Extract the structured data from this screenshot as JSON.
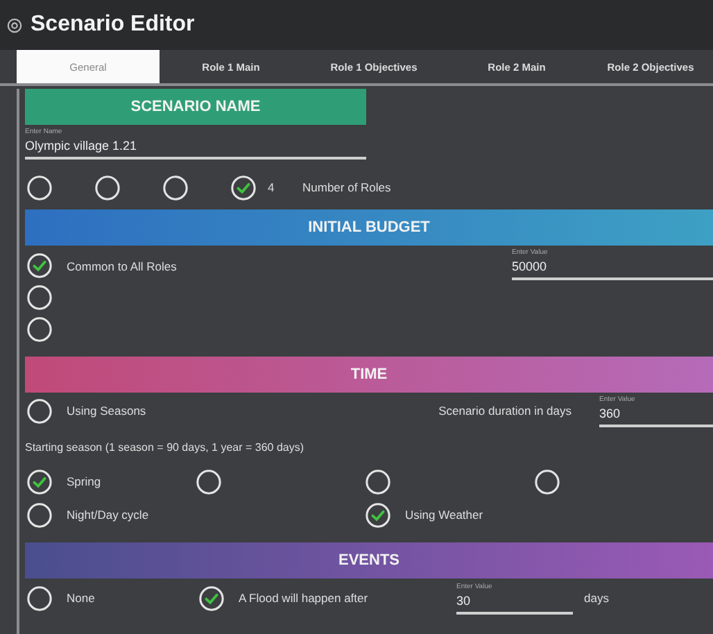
{
  "window": {
    "title": "Scenario Editor"
  },
  "tabs": [
    {
      "label": "General",
      "selected": true
    },
    {
      "label": "Role 1 Main",
      "selected": false
    },
    {
      "label": "Role 1 Objectives",
      "selected": false
    },
    {
      "label": "Role 2 Main",
      "selected": false
    },
    {
      "label": "Role 2 Objectives",
      "selected": false
    }
  ],
  "scenario_name": {
    "heading": "SCENARIO NAME",
    "field": {
      "label": "Enter Name",
      "value": "Olympic village 1.21"
    }
  },
  "roles": {
    "options": [
      {
        "selected": false
      },
      {
        "selected": false
      },
      {
        "selected": false
      },
      {
        "selected": true,
        "label": "4"
      }
    ],
    "label": "Number of Roles"
  },
  "budget": {
    "heading": "INITIAL BUDGET",
    "options": [
      {
        "label": "Common to All Roles",
        "checked": true
      },
      {
        "checked": false
      },
      {
        "checked": false
      }
    ],
    "field": {
      "label": "Enter Value",
      "value": "50000"
    }
  },
  "time": {
    "heading": "TIME",
    "using_seasons": {
      "label": "Using Seasons",
      "checked": false
    },
    "duration": {
      "label": "Scenario duration in days",
      "field": {
        "label": "Enter Value",
        "value": "360"
      }
    },
    "season_note": "Starting season (1 season = 90 days, 1 year = 360 days)",
    "seasons": [
      {
        "label": "Spring",
        "selected": true
      },
      {
        "selected": false
      },
      {
        "selected": false
      },
      {
        "selected": false
      }
    ],
    "night_day": {
      "label": "Night/Day cycle",
      "checked": false
    },
    "weather": {
      "label": "Using Weather",
      "checked": true
    }
  },
  "events": {
    "heading": "EVENTS",
    "options": [
      {
        "label": "None",
        "selected": false
      },
      {
        "label": "A Flood will happen after",
        "selected": true
      }
    ],
    "field": {
      "label": "Enter Value",
      "value": "30"
    },
    "unit": "days"
  }
}
